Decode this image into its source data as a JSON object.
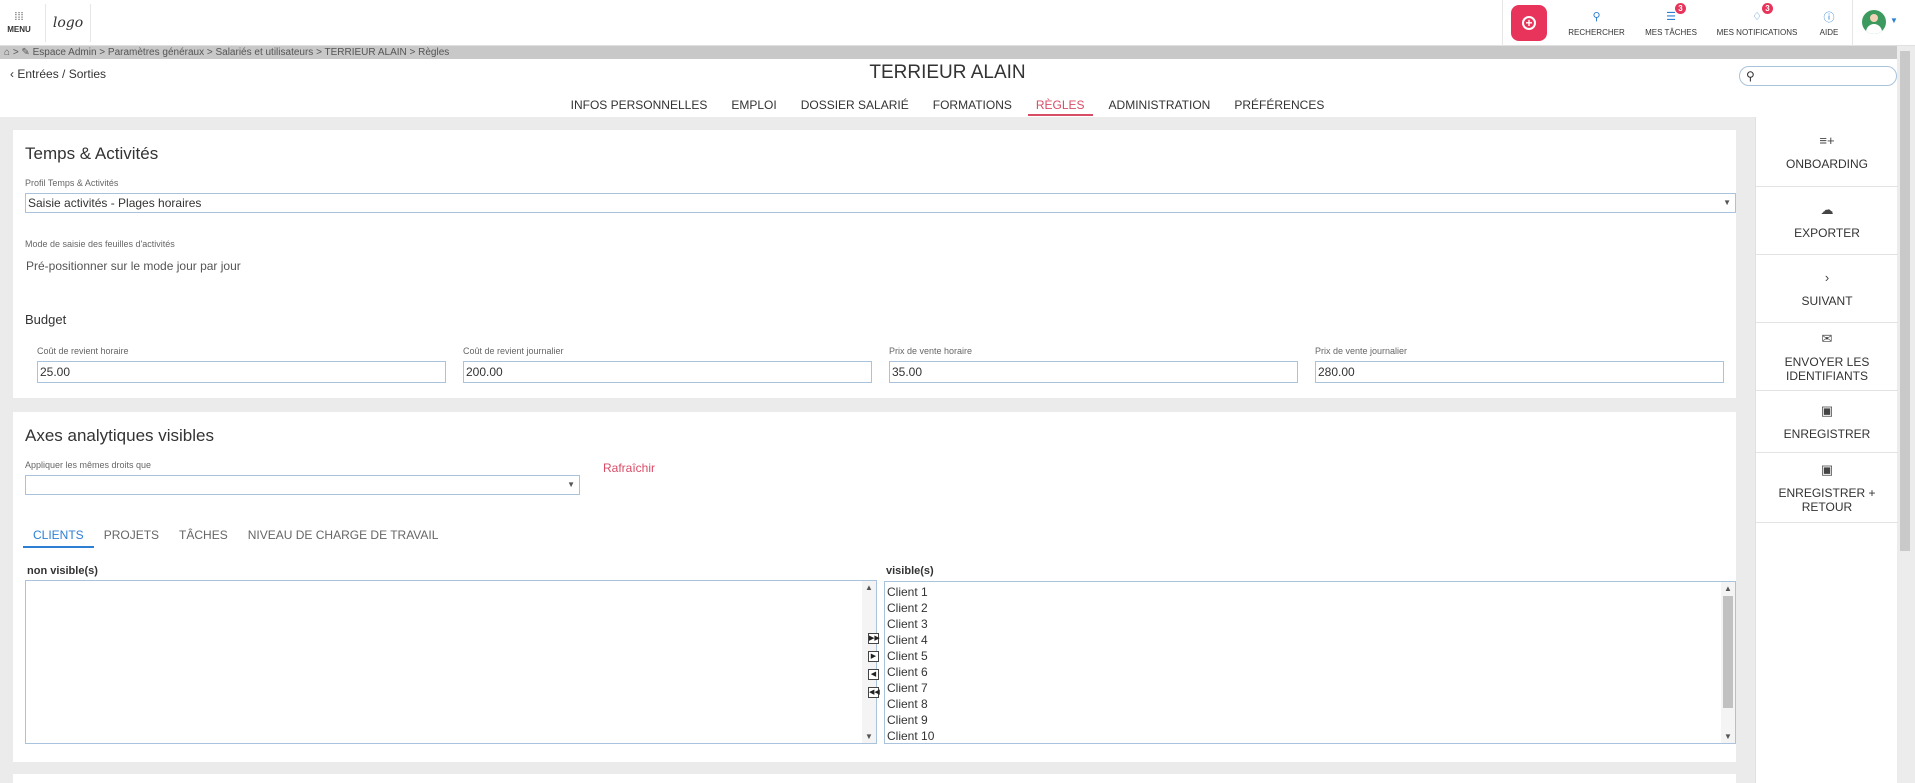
{
  "topbar": {
    "menu_label": "MENU",
    "logo_text": "logo",
    "actions": [
      {
        "label": "RECHERCHER",
        "icon": "search-icon"
      },
      {
        "label": "MES TÂCHES",
        "icon": "tasks-icon",
        "badge": "3"
      },
      {
        "label": "MES NOTIFICATIONS",
        "icon": "bell-icon",
        "badge": "3"
      },
      {
        "label": "AIDE",
        "icon": "help-icon"
      }
    ]
  },
  "breadcrumb": "⌂ > ✎ Espace Admin > Paramètres généraux > Salariés et utilisateurs > TERRIEUR ALAIN > Règles",
  "header": {
    "back_label": "Entrées / Sorties",
    "title": "TERRIEUR ALAIN",
    "tabs": [
      "INFOS PERSONNELLES",
      "EMPLOI",
      "DOSSIER SALARIÉ",
      "FORMATIONS",
      "RÈGLES",
      "ADMINISTRATION",
      "PRÉFÉRENCES"
    ],
    "active_tab": "RÈGLES"
  },
  "side_panel": [
    {
      "label": "ONBOARDING",
      "icon": "playlist-add-icon"
    },
    {
      "label": "EXPORTER",
      "icon": "cloud-download-icon"
    },
    {
      "label": "SUIVANT",
      "icon": "chevron-right-icon"
    },
    {
      "label": "ENVOYER LES IDENTIFIANTS",
      "icon": "mail-icon"
    },
    {
      "label": "ENREGISTRER",
      "icon": "save-icon"
    },
    {
      "label": "ENREGISTRER + RETOUR",
      "icon": "save-return-icon"
    }
  ],
  "temps": {
    "title": "Temps & Activités",
    "profile_label": "Profil Temps & Activités",
    "profile_value": "Saisie activités - Plages horaires",
    "mode_label": "Mode de saisie des feuilles d'activités",
    "mode_value": "Pré-positionner sur le mode jour par jour",
    "budget_title": "Budget",
    "budget_fields": [
      {
        "label": "Coût de revient horaire",
        "value": "25.00"
      },
      {
        "label": "Coût de revient journalier",
        "value": "200.00"
      },
      {
        "label": "Prix de vente horaire",
        "value": "35.00"
      },
      {
        "label": "Prix de vente journalier",
        "value": "280.00"
      }
    ]
  },
  "axes": {
    "title": "Axes analytiques visibles",
    "apply_label": "Appliquer les mêmes droits que",
    "apply_value": "",
    "refresh_label": "Rafraîchir",
    "subtabs": [
      "CLIENTS",
      "PROJETS",
      "TÂCHES",
      "NIVEAU DE CHARGE DE TRAVAIL"
    ],
    "active_subtab": "CLIENTS",
    "non_visible_label": "non visible(s)",
    "visible_label": "visible(s)",
    "non_visible_items": [],
    "visible_items": [
      "Client 1",
      "Client 2",
      "Client 3",
      "Client 4",
      "Client 5",
      "Client 6",
      "Client 7",
      "Client 8",
      "Client 9",
      "Client 10"
    ]
  }
}
